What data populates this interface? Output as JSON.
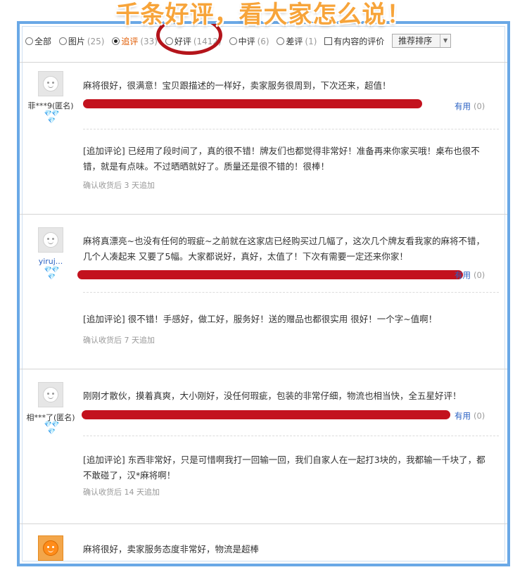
{
  "banner": "千条好评，看大家怎么说！",
  "filter": {
    "options": [
      {
        "label": "全部",
        "count": "",
        "selected": false
      },
      {
        "label": "图片",
        "count": "(25)",
        "selected": false
      },
      {
        "label": "追评",
        "count": "(33)",
        "selected": true
      },
      {
        "label": "好评",
        "count": "(1412)",
        "selected": false
      },
      {
        "label": "中评",
        "count": "(6)",
        "selected": false
      },
      {
        "label": "差评",
        "count": "(1)",
        "selected": false
      }
    ],
    "content_only": "有内容的评价",
    "sort_label": "推荐排序"
  },
  "reviews": [
    {
      "user": "菲***9(匿名)",
      "gems": "💎💎💎",
      "text": "麻将很好，很满意！宝贝跟描述的一样好，卖家服务很周到，下次还来，超值！",
      "useful_label": "有用",
      "useful_count": "(0)",
      "followup": "[追加评论] 已经用了段时间了，真的很不错！牌友们也都觉得非常好！准备再来你家买哦！桌布也很不错，就是有点味。不过晒晒就好了。质量还是很不错的！很棒！",
      "followup_meta": "确认收货后 3 天追加"
    },
    {
      "user": "yiruj...",
      "gems": "💎💎💎",
      "text": "麻将真漂亮~也没有任何的瑕疵~之前就在这家店已经购买过几幅了，这次几个牌友看我家的麻将不错，几个人凑起来 又要了5幅。大家都说好，真好，太值了！下次有需要一定还来你家！",
      "useful_label": "有用",
      "useful_count": "(0)",
      "followup": "[追加评论] 很不错！手感好，做工好，服务好！送的赠品也都很实用 很好！一个字~值啊！",
      "followup_meta": "确认收货后 7 天追加"
    },
    {
      "user": "相***了(匿名)",
      "gems": "💎💎💎",
      "text": "刚刚才散伙，摸着真爽，大小刚好，没任何瑕疵，包装的非常仔细，物流也相当快，全五星好评！",
      "useful_label": "有用",
      "useful_count": "(0)",
      "followup": "[追加评论] 东西非常好，只是可惜啊我打一回输一回，我们自家人在一起打3块的，我都输一千块了，都不敢碰了，汉*麻将啊！",
      "followup_meta": "确认收货后 14 天追加"
    },
    {
      "user": "",
      "gems": "",
      "text": "麻将很好，卖家服务态度非常好，物流是超棒"
    }
  ]
}
